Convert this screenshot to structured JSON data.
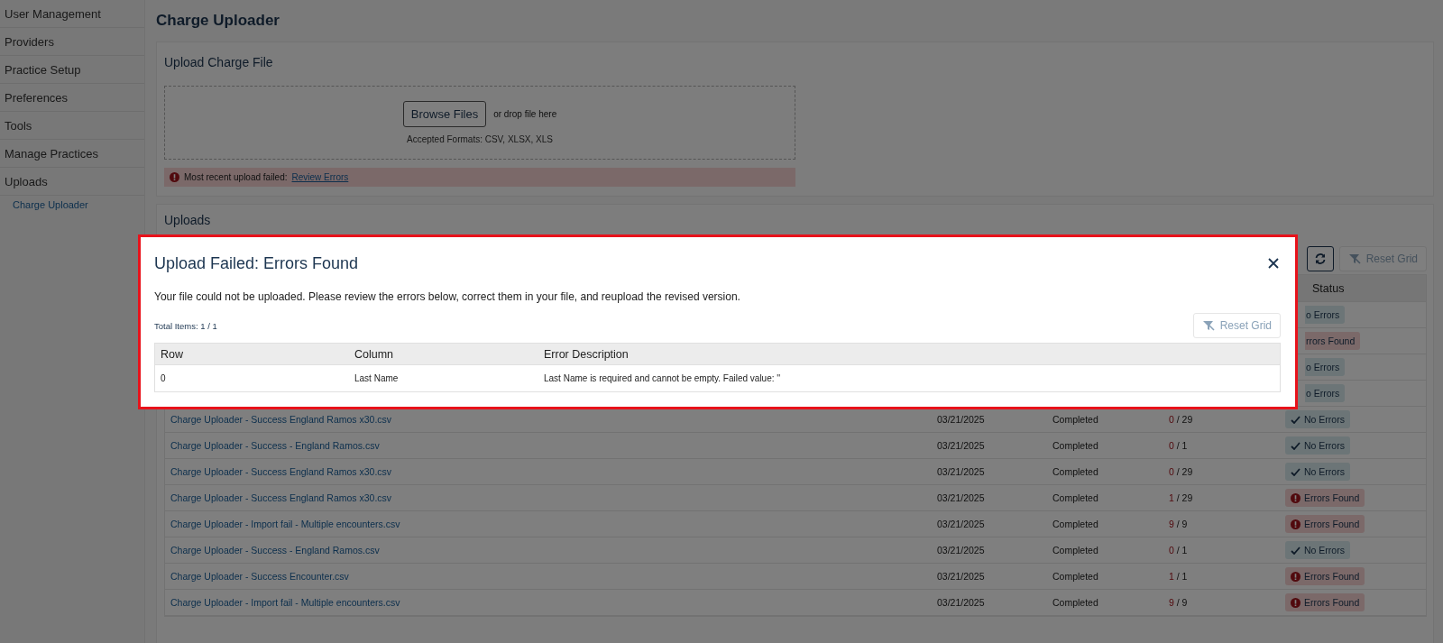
{
  "sidebar": {
    "items": [
      {
        "label": "User Management",
        "selected": false
      },
      {
        "label": "Providers",
        "selected": false
      },
      {
        "label": "Practice Setup",
        "selected": false
      },
      {
        "label": "Preferences",
        "selected": false
      },
      {
        "label": "Tools",
        "selected": false
      },
      {
        "label": "Manage Practices",
        "selected": false
      },
      {
        "label": "Uploads",
        "selected": false,
        "children": [
          {
            "label": "Charge Uploader",
            "selected": true
          }
        ]
      }
    ]
  },
  "page_title": "Charge Uploader",
  "upload_card": {
    "title": "Upload Charge File",
    "browse_button": "Browse Files",
    "drop_hint": "or drop file here",
    "formats": "Accepted Formats: CSV, XLSX, XLS",
    "alert": {
      "message": "Most recent upload failed:",
      "link": "Review Errors"
    }
  },
  "uploads_card": {
    "title": "Uploads",
    "reset_button": {
      "label": "Reset Grid",
      "disabled": true
    },
    "table": {
      "status_header": "Status",
      "rows": [
        {
          "status": {
            "kind": "ok",
            "label": "o Errors"
          }
        },
        {
          "status": {
            "kind": "error",
            "label": "rrors Found"
          }
        },
        {
          "status": {
            "kind": "ok",
            "label": "o Errors"
          }
        },
        {
          "status": {
            "kind": "ok",
            "label": "o Errors"
          }
        },
        {
          "name": "Charge Uploader - Success England Ramos x30.csv",
          "date": "03/21/2025",
          "state": "Completed",
          "errors": "0",
          "total": "/ 29",
          "status": {
            "kind": "ok",
            "label": "No Errors"
          }
        },
        {
          "name": "Charge Uploader - Success - England Ramos.csv",
          "date": "03/21/2025",
          "state": "Completed",
          "errors": "0",
          "total": "/ 1",
          "status": {
            "kind": "ok",
            "label": "No Errors"
          }
        },
        {
          "name": "Charge Uploader - Success England Ramos x30.csv",
          "date": "03/21/2025",
          "state": "Completed",
          "errors": "0",
          "total": "/ 29",
          "status": {
            "kind": "ok",
            "label": "No Errors"
          }
        },
        {
          "name": "Charge Uploader - Success England Ramos x30.csv",
          "date": "03/21/2025",
          "state": "Completed",
          "errors": "1",
          "total": "/ 29",
          "status": {
            "kind": "error",
            "label": "Errors Found"
          }
        },
        {
          "name": "Charge Uploader - Import fail - Multiple encounters.csv",
          "date": "03/21/2025",
          "state": "Completed",
          "errors": "9",
          "total": "/ 9",
          "status": {
            "kind": "error",
            "label": "Errors Found"
          }
        },
        {
          "name": "Charge Uploader - Success - England Ramos.csv",
          "date": "03/21/2025",
          "state": "Completed",
          "errors": "0",
          "total": "/ 1",
          "status": {
            "kind": "ok",
            "label": "No Errors"
          }
        },
        {
          "name": "Charge Uploader - Success Encounter.csv",
          "date": "03/21/2025",
          "state": "Completed",
          "errors": "1",
          "total": "/ 1",
          "status": {
            "kind": "error",
            "label": "Errors Found"
          }
        },
        {
          "name": "Charge Uploader - Import fail - Multiple encounters.csv",
          "date": "03/21/2025",
          "state": "Completed",
          "errors": "9",
          "total": "/ 9",
          "status": {
            "kind": "error",
            "label": "Errors Found"
          }
        }
      ]
    }
  },
  "modal": {
    "title": "Upload Failed: Errors Found",
    "message": "Your file could not be uploaded. Please review the errors below, correct them in your file, and reupload the revised version.",
    "total_items": "Total Items: 1 / 1",
    "reset_button": {
      "label": "Reset Grid",
      "disabled": true
    },
    "grid": {
      "columns": [
        "Row",
        "Column",
        "Error Description"
      ],
      "rows": [
        [
          "0",
          "Last Name",
          "Last Name is required and cannot be empty. Failed value: ''"
        ]
      ]
    }
  }
}
